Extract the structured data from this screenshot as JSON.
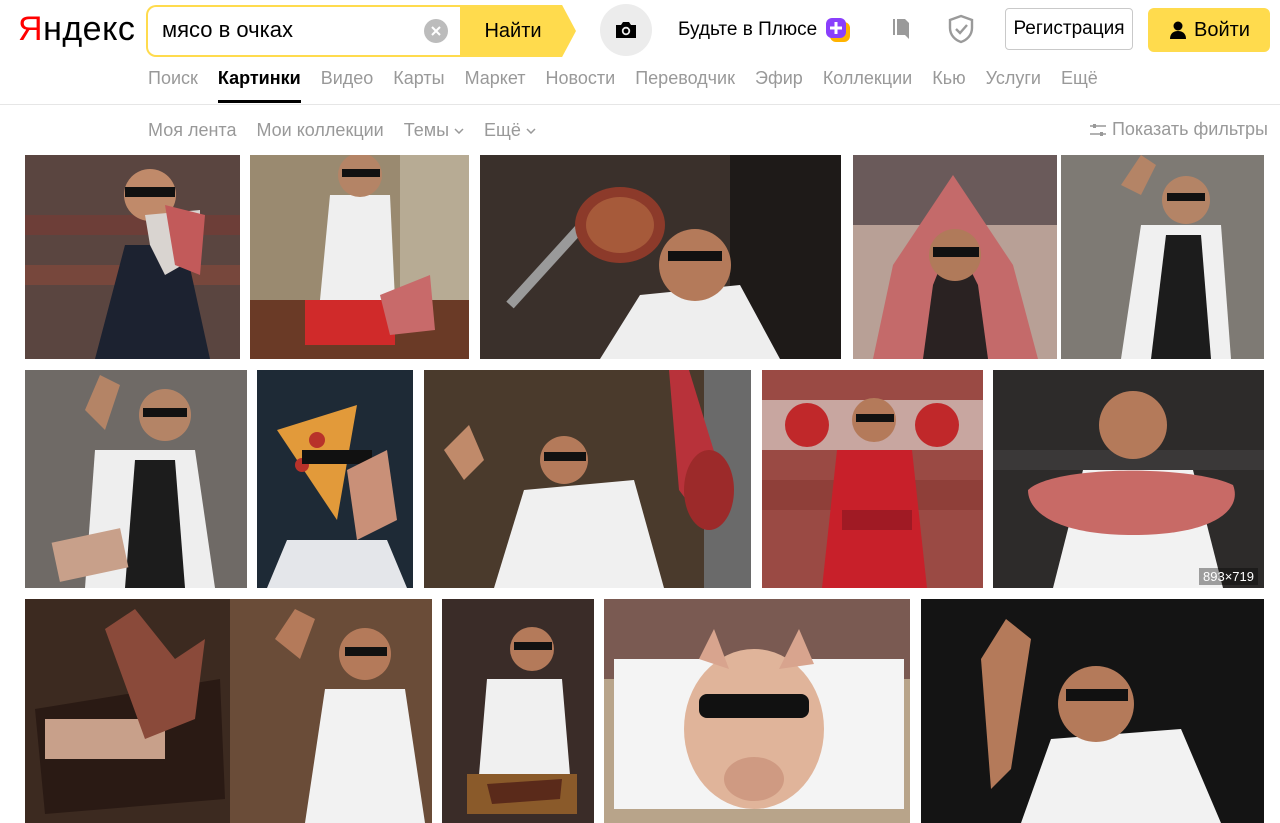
{
  "logo": {
    "first": "Я",
    "rest": "ндекс"
  },
  "search": {
    "query": "мясо в очках",
    "button_label": "Найти"
  },
  "plus": {
    "label": "Будьте в Плюсе"
  },
  "auth": {
    "register_label": "Регистрация",
    "login_label": "Войти"
  },
  "tabs": [
    {
      "label": "Поиск"
    },
    {
      "label": "Картинки",
      "active": true
    },
    {
      "label": "Видео"
    },
    {
      "label": "Карты"
    },
    {
      "label": "Маркет"
    },
    {
      "label": "Новости"
    },
    {
      "label": "Переводчик"
    },
    {
      "label": "Эфир"
    },
    {
      "label": "Коллекции"
    },
    {
      "label": "Кью"
    },
    {
      "label": "Услуги"
    },
    {
      "label": "Ещё"
    }
  ],
  "subnav": {
    "my_feed": "Моя лента",
    "my_collections": "Мои коллекции",
    "themes": "Темы",
    "more": "Ещё"
  },
  "filters": {
    "label": "Показать фильтры"
  },
  "images": [
    {
      "bg": "#5a4540"
    },
    {
      "bg": "#9a8a70"
    },
    {
      "bg": "#3a302b"
    },
    {
      "bg": "#b8a096"
    },
    {
      "bg": "#7e7a74"
    },
    {
      "bg": "#6f6a66"
    },
    {
      "bg": "#1e2a36"
    },
    {
      "bg": "#4a3a2c"
    },
    {
      "bg": "#9a4a44"
    },
    {
      "bg": "#2d2b2a"
    },
    {
      "bg": "#6a4c38"
    },
    {
      "bg": "#3a2c28"
    },
    {
      "bg": "#b8a48a"
    },
    {
      "bg": "#141414"
    }
  ],
  "size_label": "893×719",
  "colors": {
    "accent": "#ffdb4d",
    "logo_red": "#ff0000",
    "muted": "#999999"
  }
}
